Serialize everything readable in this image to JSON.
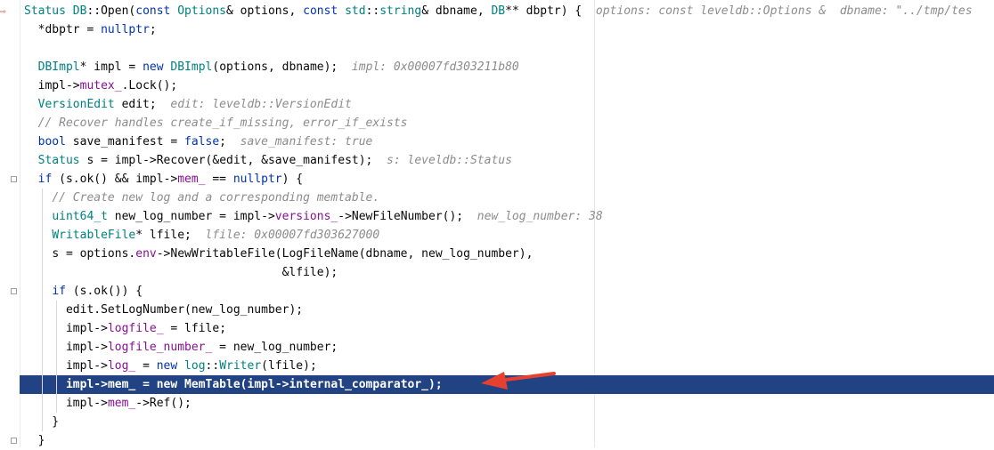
{
  "editor": {
    "execution_marker": "⇨",
    "lines": [
      {
        "text": "Status DB::Open(const Options& options, const std::string& dbname, DB** dbptr) {",
        "hint": "options: const leveldb::Options &  dbname: \"../tmp/tes"
      },
      {
        "text": "  *dbptr = nullptr;",
        "hint": ""
      },
      {
        "text": "",
        "hint": ""
      },
      {
        "text": "  DBImpl* impl = new DBImpl(options, dbname);",
        "hint": "impl: 0x00007fd303211b80"
      },
      {
        "text": "  impl->mutex_.Lock();",
        "hint": ""
      },
      {
        "text": "  VersionEdit edit;",
        "hint": "edit: leveldb::VersionEdit"
      },
      {
        "text": "  // Recover handles create_if_missing, error_if_exists",
        "hint": ""
      },
      {
        "text": "  bool save_manifest = false;",
        "hint": "save_manifest: true"
      },
      {
        "text": "  Status s = impl->Recover(&edit, &save_manifest);",
        "hint": "s: leveldb::Status"
      },
      {
        "text": "  if (s.ok() && impl->mem_ == nullptr) {",
        "hint": ""
      },
      {
        "text": "    // Create new log and a corresponding memtable.",
        "hint": ""
      },
      {
        "text": "    uint64_t new_log_number = impl->versions_->NewFileNumber();",
        "hint": "new_log_number: 38"
      },
      {
        "text": "    WritableFile* lfile;",
        "hint": "lfile: 0x00007fd303627000"
      },
      {
        "text": "    s = options.env->NewWritableFile(LogFileName(dbname, new_log_number),",
        "hint": ""
      },
      {
        "text": "                                     &lfile);",
        "hint": ""
      },
      {
        "text": "    if (s.ok()) {",
        "hint": ""
      },
      {
        "text": "      edit.SetLogNumber(new_log_number);",
        "hint": ""
      },
      {
        "text": "      impl->logfile_ = lfile;",
        "hint": ""
      },
      {
        "text": "      impl->logfile_number_ = new_log_number;",
        "hint": ""
      },
      {
        "text": "      impl->log_ = new log::Writer(lfile);",
        "hint": ""
      },
      {
        "text": "      impl->mem_ = new MemTable(impl->internal_comparator_);",
        "hint": ""
      },
      {
        "text": "      impl->mem_->Ref();",
        "hint": ""
      },
      {
        "text": "    }",
        "hint": ""
      },
      {
        "text": "  }",
        "hint": ""
      }
    ],
    "highlighted_line_index": 20,
    "colors": {
      "highlight_bg": "#214283",
      "keyword": "#0033b3",
      "type": "#008080",
      "field": "#871094",
      "comment": "#8c8c8c",
      "annotation_arrow": "#e8402f"
    }
  }
}
